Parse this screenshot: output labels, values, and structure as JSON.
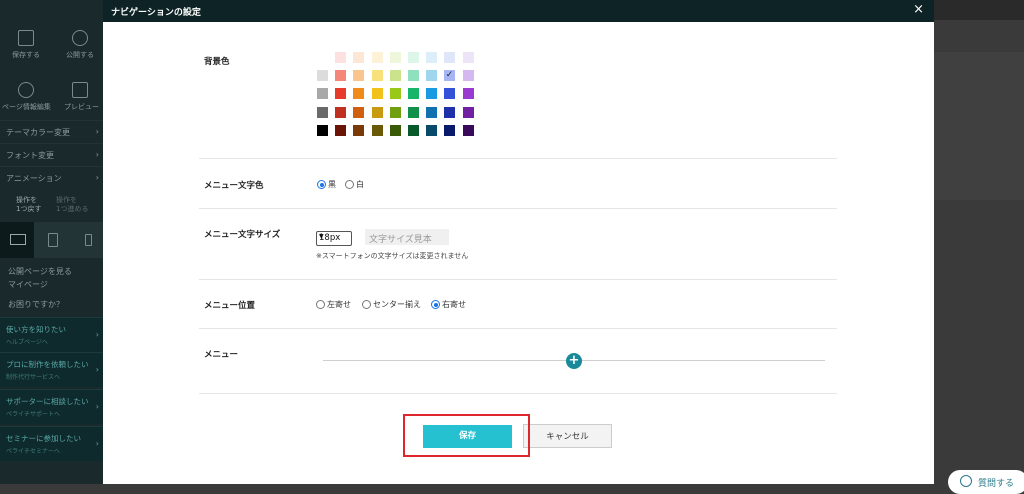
{
  "modal": {
    "title": "ナビゲーションの設定",
    "close_icon": "×"
  },
  "background_color": {
    "label": "背景色",
    "palette": [
      [
        "",
        "#fde0e0",
        "#fde6d6",
        "#fdf2d8",
        "#eef6dc",
        "#dcf6ea",
        "#dceef8",
        "#e0e6fa",
        "#eee4f8"
      ],
      [
        "#dcdcdc",
        "#f5877a",
        "#fbc590",
        "#f8e07a",
        "#cbe38a",
        "#8fe0be",
        "#9fd6ee",
        "#a6b6f4",
        "#d6b8f0"
      ],
      [
        "#a8a8a8",
        "#e83a2a",
        "#f08a1a",
        "#f0c21a",
        "#9ac818",
        "#18b46a",
        "#1a9ae0",
        "#3452d8",
        "#9a3ad0"
      ],
      [
        "#6a6a6a",
        "#c03020",
        "#d06010",
        "#c89a10",
        "#70a010",
        "#10904a",
        "#1070b0",
        "#2030a8",
        "#7020a0"
      ],
      [
        "#000000",
        "#6a1408",
        "#7a3a08",
        "#6a5a08",
        "#3a5a08",
        "#085a2a",
        "#084a6a",
        "#0a1a6a",
        "#3a0a5a"
      ]
    ],
    "selected_row": 1,
    "selected_col": 7,
    "check_icon": "✓"
  },
  "menu_text_color": {
    "label": "メニュー文字色",
    "options": [
      "黒",
      "白"
    ],
    "selected": 0
  },
  "menu_font_size": {
    "label": "メニュー文字サイズ",
    "value": "18px",
    "sample": "文字サイズ見本",
    "note": "※スマートフォンの文字サイズは変更されません"
  },
  "menu_position": {
    "label": "メニュー位置",
    "options": [
      "左寄せ",
      "センター揃え",
      "右寄せ"
    ],
    "selected": 2
  },
  "menu": {
    "label": "メニュー",
    "add_icon": "+"
  },
  "buttons": {
    "save": "保存",
    "cancel": "キャンセル"
  },
  "sidebar": {
    "top_items": [
      "保存する",
      "公開する",
      "ページ情報編集",
      "プレビュー"
    ],
    "menus": [
      "テーマカラー変更",
      "フォント変更",
      "アニメーション"
    ],
    "undo": [
      "操作を",
      "1つ戻す"
    ],
    "redo": [
      "操作を",
      "1つ進める"
    ],
    "links": [
      "公開ページを見る",
      "マイページ"
    ],
    "help_title": "お困りですか？",
    "blocks": [
      {
        "t1": "使い方を知りたい",
        "t2": "ヘルプページへ"
      },
      {
        "t1": "プロに制作を依頼したい",
        "t2": "制作代行サービスへ"
      },
      {
        "t1": "サポーターに相談したい",
        "t2": "ペライチサポートへ"
      },
      {
        "t1": "セミナーに参加したい",
        "t2": "ペライチセミナーへ"
      }
    ],
    "chevron": "›"
  },
  "help_button": "質問する"
}
